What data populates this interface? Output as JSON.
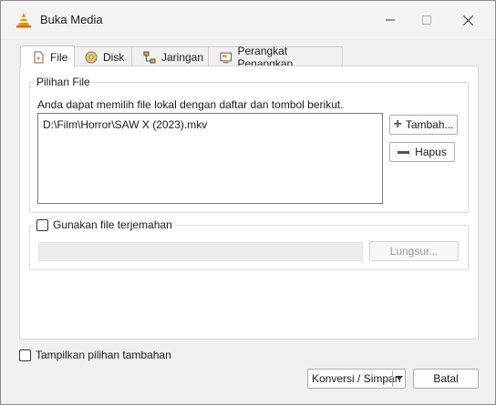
{
  "window": {
    "title": "Buka Media",
    "controls": {
      "minimize": "—",
      "maximize": "☐",
      "close": "✕"
    }
  },
  "tabs": [
    {
      "label": "File",
      "icon": "file-icon",
      "active": true
    },
    {
      "label": "Disk",
      "icon": "disc-icon",
      "active": false
    },
    {
      "label": "Jaringan",
      "icon": "network-icon",
      "active": false
    },
    {
      "label": "Perangkat Penangkap",
      "icon": "capture-device-icon",
      "active": false
    }
  ],
  "file_group": {
    "label": "Pilihan File",
    "hint": "Anda dapat memilih file lokal dengan daftar dan tombol berikut.",
    "files": [
      "D:\\Film\\Horror\\SAW X (2023).mkv"
    ],
    "add_label": "Tambah...",
    "remove_label": "Hapus"
  },
  "subtitle": {
    "checkbox_label": "Gunakan file terjemahan",
    "checked": false,
    "browse_label": "Lungsur..."
  },
  "footer": {
    "more_options_label": "Tampilkan pilihan tambahan",
    "convert_label": "Konversi / Simpan",
    "cancel_label": "Batal"
  },
  "colors": {
    "accent": "#f28c00",
    "border": "#adadad"
  }
}
